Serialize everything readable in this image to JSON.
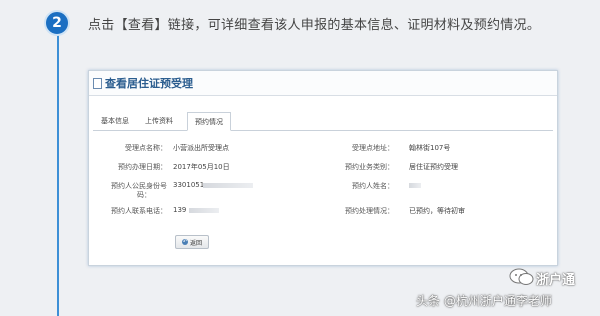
{
  "step": {
    "number": "2",
    "instruction": "点击【查看】链接，可详细查看该人申报的基本信息、证明材料及预约情况。"
  },
  "panel": {
    "title": "查看居住证预受理",
    "tabs": [
      "基本信息",
      "上传资料",
      "预约情况"
    ],
    "active_tab": "预约情况",
    "fields": {
      "office_name_label": "受理点名称：",
      "office_name_value": "小营派出所受理点",
      "office_addr_label": "受理点地址：",
      "office_addr_value": "翰林街107号",
      "date_label": "预约办理日期：",
      "date_value": "2017年05月10日",
      "biz_type_label": "预约业务类别：",
      "biz_type_value": "居住证预约受理",
      "id_label_line1": "预约人公民身份号",
      "id_label_line2": "码：",
      "id_value_visible": "3301051",
      "name_label": "预约人姓名：",
      "phone_label": "预约人联系电话：",
      "phone_value_visible": "139",
      "status_label": "预约处理情况：",
      "status_value": "已预约，等待初审"
    },
    "back_button": "返回"
  },
  "watermark": {
    "account": "浙户通",
    "author": "头条 @杭州浙户通李老师"
  },
  "colors": {
    "accent": "#1b6fc2",
    "timeline": "#3d8fd6",
    "title": "#2b5d8f"
  }
}
